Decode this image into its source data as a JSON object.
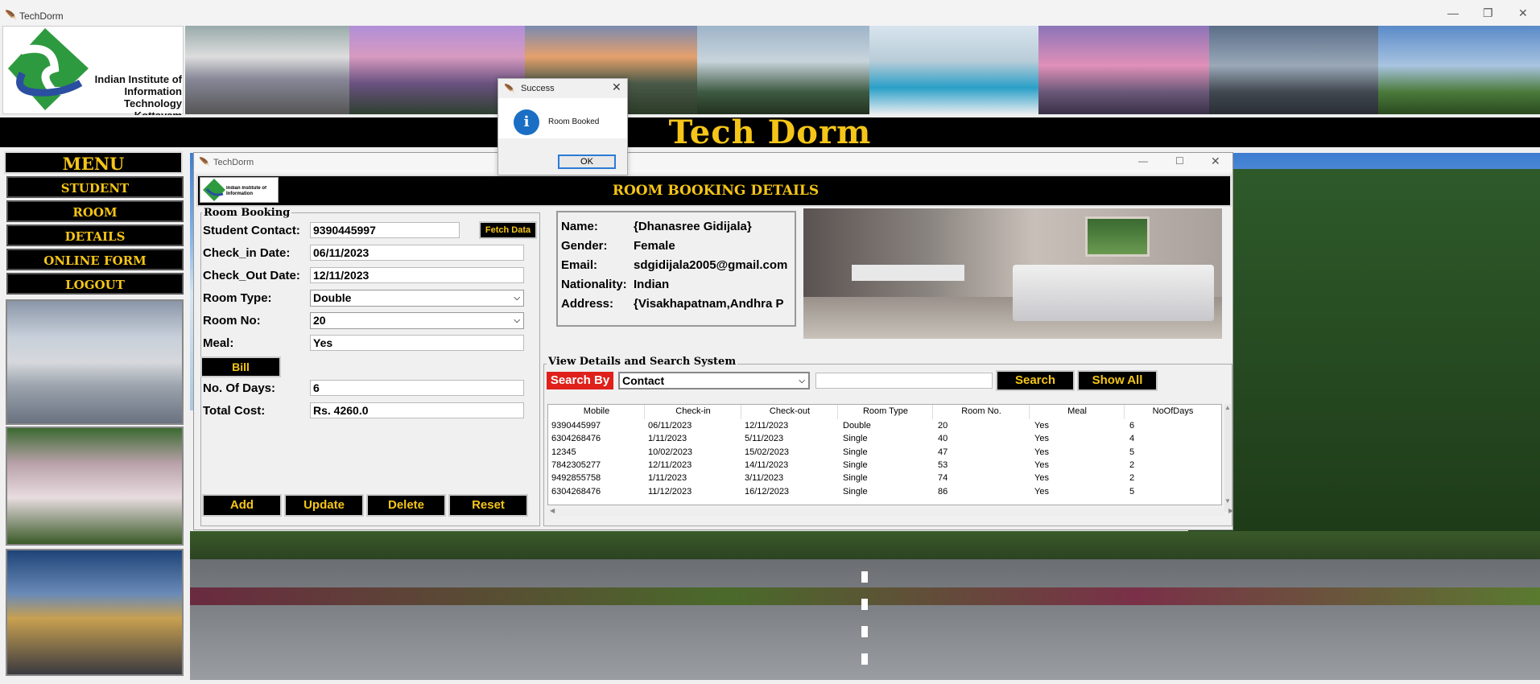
{
  "app_title": "TechDorm",
  "logo": {
    "line1": "Indian Institute of",
    "line2": "Information Technology",
    "line3": "Kottayam"
  },
  "banner_title": "Tech Dorm",
  "menu": {
    "heading": "MENU",
    "items": [
      "STUDENT",
      "ROOM",
      "DETAILS",
      "ONLINE FORM",
      "LOGOUT"
    ]
  },
  "child_window": {
    "title": "TechDorm",
    "header": "ROOM BOOKING DETAILS",
    "logo_text": "Indian Institute of Information Technology"
  },
  "room_booking": {
    "group_title": "Room Booking",
    "labels": {
      "contact": "Student Contact:",
      "checkin": "Check_in Date:",
      "checkout": "Check_Out Date:",
      "room_type": "Room Type:",
      "room_no": "Room No:",
      "meal": "Meal:",
      "days": "No. Of Days:",
      "total": "Total Cost:"
    },
    "values": {
      "contact": "9390445997",
      "checkin": "06/11/2023",
      "checkout": "12/11/2023",
      "room_type": "Double",
      "room_no": "20",
      "meal": "Yes",
      "days": "6",
      "total": "Rs. 4260.0"
    },
    "fetch_button": "Fetch Data",
    "bill_button": "Bill",
    "actions": [
      "Add",
      "Update",
      "Delete",
      "Reset"
    ]
  },
  "student_info": {
    "labels": [
      "Name:",
      "Gender:",
      "Email:",
      "Nationality:",
      "Address:"
    ],
    "values": [
      "{Dhanasree Gidijala}",
      "Female",
      "sdgidijala2005@gmail.com",
      "Indian",
      "{Visakhapatnam,Andhra P"
    ]
  },
  "search": {
    "group_title": "View Details and Search System",
    "search_by_label": "Search By",
    "search_by_value": "Contact",
    "search_text": "",
    "search_button": "Search",
    "show_all_button": "Show All"
  },
  "table": {
    "columns": [
      "Mobile",
      "Check-in",
      "Check-out",
      "Room Type",
      "Room No.",
      "Meal",
      "NoOfDays"
    ],
    "rows": [
      [
        "9390445997",
        "06/11/2023",
        "12/11/2023",
        "Double",
        "20",
        "Yes",
        "6"
      ],
      [
        "6304268476",
        "1/11/2023",
        "5/11/2023",
        "Single",
        "40",
        "Yes",
        "4"
      ],
      [
        "12345",
        "10/02/2023",
        "15/02/2023",
        "Single",
        "47",
        "Yes",
        "5"
      ],
      [
        "7842305277",
        "12/11/2023",
        "14/11/2023",
        "Single",
        "53",
        "Yes",
        "2"
      ],
      [
        "9492855758",
        "1/11/2023",
        "3/11/2023",
        "Single",
        "74",
        "Yes",
        "2"
      ],
      [
        "6304268476",
        "11/12/2023",
        "16/12/2023",
        "Single",
        "86",
        "Yes",
        "5"
      ]
    ]
  },
  "dialog": {
    "title": "Success",
    "message": "Room Booked",
    "ok_button": "OK"
  },
  "colors": {
    "accent_yellow": "#f5c518",
    "black": "#000000",
    "search_by_red": "#e0201b"
  }
}
